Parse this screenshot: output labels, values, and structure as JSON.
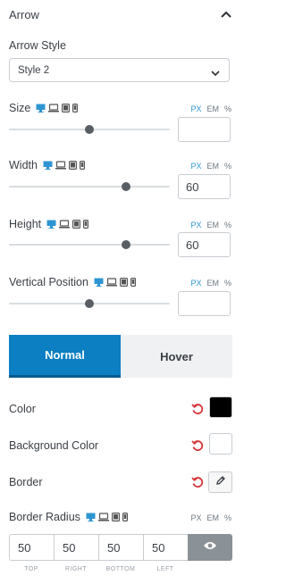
{
  "section": {
    "title": "Arrow"
  },
  "arrow_style": {
    "label": "Arrow Style",
    "value": "Style 2"
  },
  "size": {
    "label": "Size",
    "units": [
      "PX",
      "EM",
      "%"
    ],
    "active_unit": "PX",
    "value": "",
    "slider_fraction": 0.5
  },
  "width": {
    "label": "Width",
    "units": [
      "PX",
      "EM",
      "%"
    ],
    "active_unit": "PX",
    "value": "60",
    "slider_fraction": 0.73
  },
  "height": {
    "label": "Height",
    "units": [
      "PX",
      "EM",
      "%"
    ],
    "active_unit": "PX",
    "value": "60",
    "slider_fraction": 0.73
  },
  "vertical_position": {
    "label": "Vertical Position",
    "units": [
      "PX",
      "EM",
      "%"
    ],
    "active_unit": "PX",
    "value": "",
    "slider_fraction": 0.5
  },
  "tabs": [
    {
      "label": "Normal",
      "active": true
    },
    {
      "label": "Hover",
      "active": false
    }
  ],
  "color": {
    "label": "Color",
    "value": "#000000"
  },
  "background_color": {
    "label": "Background Color",
    "value": "#ffffff"
  },
  "border": {
    "label": "Border"
  },
  "border_radius": {
    "label": "Border Radius",
    "units": [
      "PX",
      "EM",
      "%"
    ],
    "values": {
      "top": "50",
      "right": "50",
      "bottom": "50",
      "left": "50"
    },
    "side_labels": [
      "TOP",
      "RIGHT",
      "BOTTOM",
      "LEFT"
    ]
  },
  "colors": {
    "accent": "#0b7fc2",
    "reset": "#d63638",
    "unit_active": "#2e95d3"
  },
  "icons": [
    "chevron-up-icon",
    "chevron-down-icon",
    "desktop-icon",
    "laptop-icon",
    "tablet-icon",
    "mobile-icon",
    "reset-icon",
    "pencil-icon",
    "eye-icon"
  ]
}
